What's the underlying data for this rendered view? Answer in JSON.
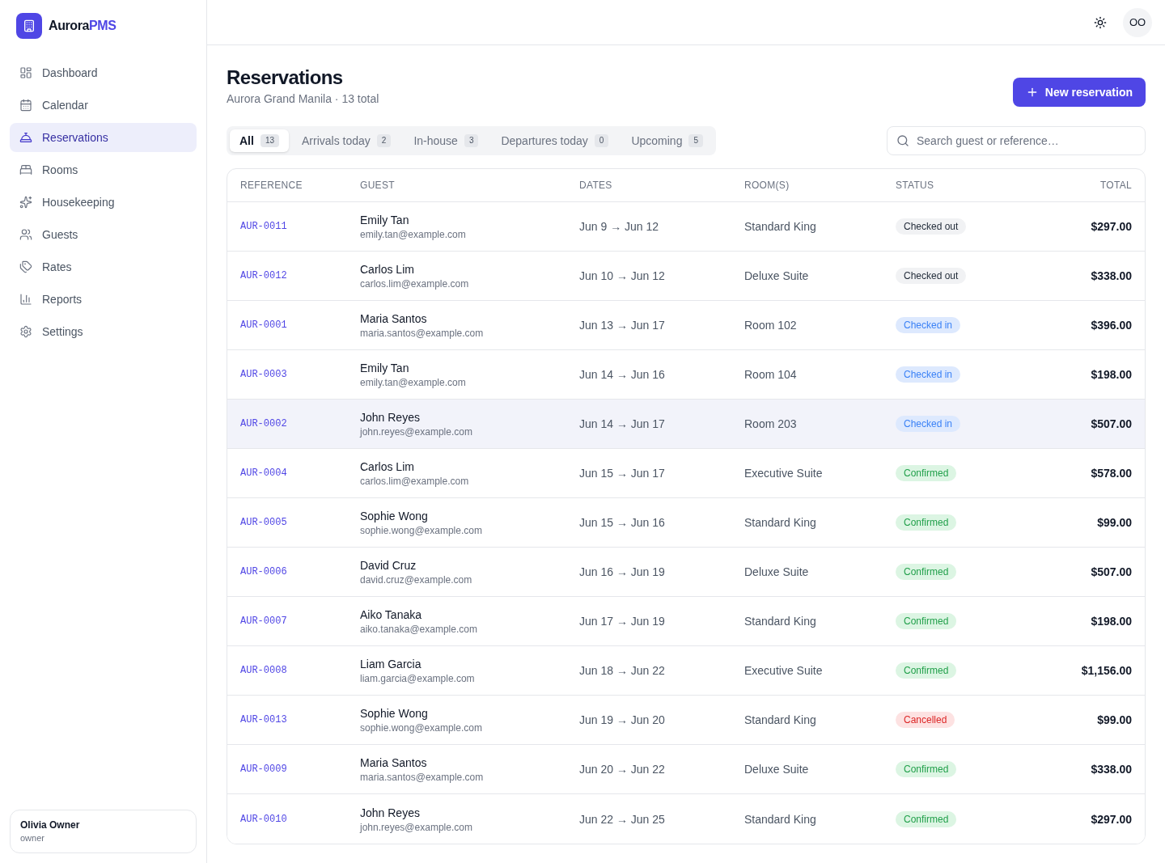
{
  "sidebar": {
    "brand": {
      "name": "Aurora",
      "suffix": "PMS"
    },
    "nav": [
      {
        "label": "Dashboard",
        "selected": false
      },
      {
        "label": "Calendar",
        "selected": false
      },
      {
        "label": "Reservations",
        "selected": true
      },
      {
        "label": "Rooms",
        "selected": false
      },
      {
        "label": "Housekeeping",
        "selected": false
      },
      {
        "label": "Guests",
        "selected": false
      },
      {
        "label": "Rates",
        "selected": false
      },
      {
        "label": "Reports",
        "selected": false
      },
      {
        "label": "Settings",
        "selected": false
      }
    ],
    "user": {
      "name": "Olivia Owner",
      "role": "owner"
    }
  },
  "topbar": {
    "avatar_initials": "OO"
  },
  "page": {
    "title": "Reservations",
    "subtitle": "Aurora Grand Manila · 13 total"
  },
  "new_button": {
    "label": "New reservation"
  },
  "tabs": [
    {
      "label": "All",
      "count": "13",
      "selected": true
    },
    {
      "label": "Arrivals today",
      "count": "2",
      "selected": false
    },
    {
      "label": "In-house",
      "count": "3",
      "selected": false
    },
    {
      "label": "Departures today",
      "count": "0",
      "selected": false
    },
    {
      "label": "Upcoming",
      "count": "5",
      "selected": false
    }
  ],
  "search": {
    "placeholder": "Search guest or reference…"
  },
  "table": {
    "columns": [
      "REFERENCE",
      "GUEST",
      "DATES",
      "ROOM(S)",
      "STATUS",
      "TOTAL"
    ],
    "rows": [
      {
        "reference": "AUR-0011",
        "guest": "Emily Tan",
        "email": "emily.tan@example.com",
        "dates": "Jun 9 → Jun 12",
        "room": "Standard King",
        "status": {
          "label": "Checked out",
          "kind": "checked_out"
        },
        "total": "$297.00",
        "highlighted": false
      },
      {
        "reference": "AUR-0012",
        "guest": "Carlos Lim",
        "email": "carlos.lim@example.com",
        "dates": "Jun 10 → Jun 12",
        "room": "Deluxe Suite",
        "status": {
          "label": "Checked out",
          "kind": "checked_out"
        },
        "total": "$338.00",
        "highlighted": false
      },
      {
        "reference": "AUR-0001",
        "guest": "Maria Santos",
        "email": "maria.santos@example.com",
        "dates": "Jun 13 → Jun 17",
        "room": "Room 102",
        "status": {
          "label": "Checked in",
          "kind": "checked_in"
        },
        "total": "$396.00",
        "highlighted": false
      },
      {
        "reference": "AUR-0003",
        "guest": "Emily Tan",
        "email": "emily.tan@example.com",
        "dates": "Jun 14 → Jun 16",
        "room": "Room 104",
        "status": {
          "label": "Checked in",
          "kind": "checked_in"
        },
        "total": "$198.00",
        "highlighted": false
      },
      {
        "reference": "AUR-0002",
        "guest": "John Reyes",
        "email": "john.reyes@example.com",
        "dates": "Jun 14 → Jun 17",
        "room": "Room 203",
        "status": {
          "label": "Checked in",
          "kind": "checked_in"
        },
        "total": "$507.00",
        "highlighted": true
      },
      {
        "reference": "AUR-0004",
        "guest": "Carlos Lim",
        "email": "carlos.lim@example.com",
        "dates": "Jun 15 → Jun 17",
        "room": "Executive Suite",
        "status": {
          "label": "Confirmed",
          "kind": "confirmed"
        },
        "total": "$578.00",
        "highlighted": false
      },
      {
        "reference": "AUR-0005",
        "guest": "Sophie Wong",
        "email": "sophie.wong@example.com",
        "dates": "Jun 15 → Jun 16",
        "room": "Standard King",
        "status": {
          "label": "Confirmed",
          "kind": "confirmed"
        },
        "total": "$99.00",
        "highlighted": false
      },
      {
        "reference": "AUR-0006",
        "guest": "David Cruz",
        "email": "david.cruz@example.com",
        "dates": "Jun 16 → Jun 19",
        "room": "Deluxe Suite",
        "status": {
          "label": "Confirmed",
          "kind": "confirmed"
        },
        "total": "$507.00",
        "highlighted": false
      },
      {
        "reference": "AUR-0007",
        "guest": "Aiko Tanaka",
        "email": "aiko.tanaka@example.com",
        "dates": "Jun 17 → Jun 19",
        "room": "Standard King",
        "status": {
          "label": "Confirmed",
          "kind": "confirmed"
        },
        "total": "$198.00",
        "highlighted": false
      },
      {
        "reference": "AUR-0008",
        "guest": "Liam Garcia",
        "email": "liam.garcia@example.com",
        "dates": "Jun 18 → Jun 22",
        "room": "Executive Suite",
        "status": {
          "label": "Confirmed",
          "kind": "confirmed"
        },
        "total": "$1,156.00",
        "highlighted": false
      },
      {
        "reference": "AUR-0013",
        "guest": "Sophie Wong",
        "email": "sophie.wong@example.com",
        "dates": "Jun 19 → Jun 20",
        "room": "Standard King",
        "status": {
          "label": "Cancelled",
          "kind": "cancelled"
        },
        "total": "$99.00",
        "highlighted": false
      },
      {
        "reference": "AUR-0009",
        "guest": "Maria Santos",
        "email": "maria.santos@example.com",
        "dates": "Jun 20 → Jun 22",
        "room": "Deluxe Suite",
        "status": {
          "label": "Confirmed",
          "kind": "confirmed"
        },
        "total": "$338.00",
        "highlighted": false
      },
      {
        "reference": "AUR-0010",
        "guest": "John Reyes",
        "email": "john.reyes@example.com",
        "dates": "Jun 22 → Jun 25",
        "room": "Standard King",
        "status": {
          "label": "Confirmed",
          "kind": "confirmed"
        },
        "total": "$297.00",
        "highlighted": false
      }
    ]
  }
}
